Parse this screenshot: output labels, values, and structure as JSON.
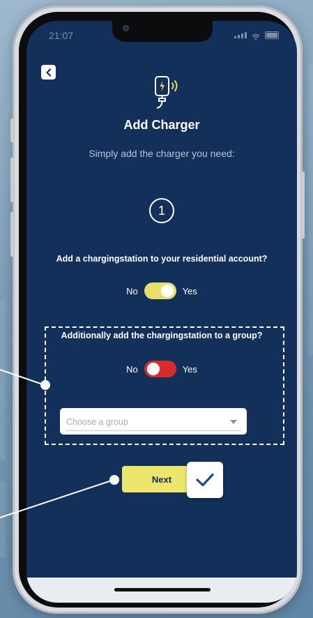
{
  "status_bar": {
    "time": "21:07",
    "icons": [
      "signal-icon",
      "wifi-icon",
      "battery-icon"
    ]
  },
  "header": {
    "back_icon": "chevron-left-icon",
    "main_icon": "charger-wireless-icon",
    "title": "Add Charger",
    "subtitle": "Simply add the charger you need:"
  },
  "step": {
    "number": "1"
  },
  "residential": {
    "question": "Add a chargingstation to your residential account?",
    "toggle_no": "No",
    "toggle_yes": "Yes",
    "value": "Yes"
  },
  "group": {
    "question": "Additionally add the chargingstation to a group?",
    "toggle_no": "No",
    "toggle_yes": "Yes",
    "value": "No",
    "select_placeholder": "Choose a group"
  },
  "actions": {
    "next_label": "Next",
    "check_icon": "checkmark-icon"
  },
  "colors": {
    "screen_bg": "#12305a",
    "accent_yellow": "#ece66f",
    "toggle_off_red": "#d72c2c",
    "check_blue": "#1b4a8a"
  }
}
